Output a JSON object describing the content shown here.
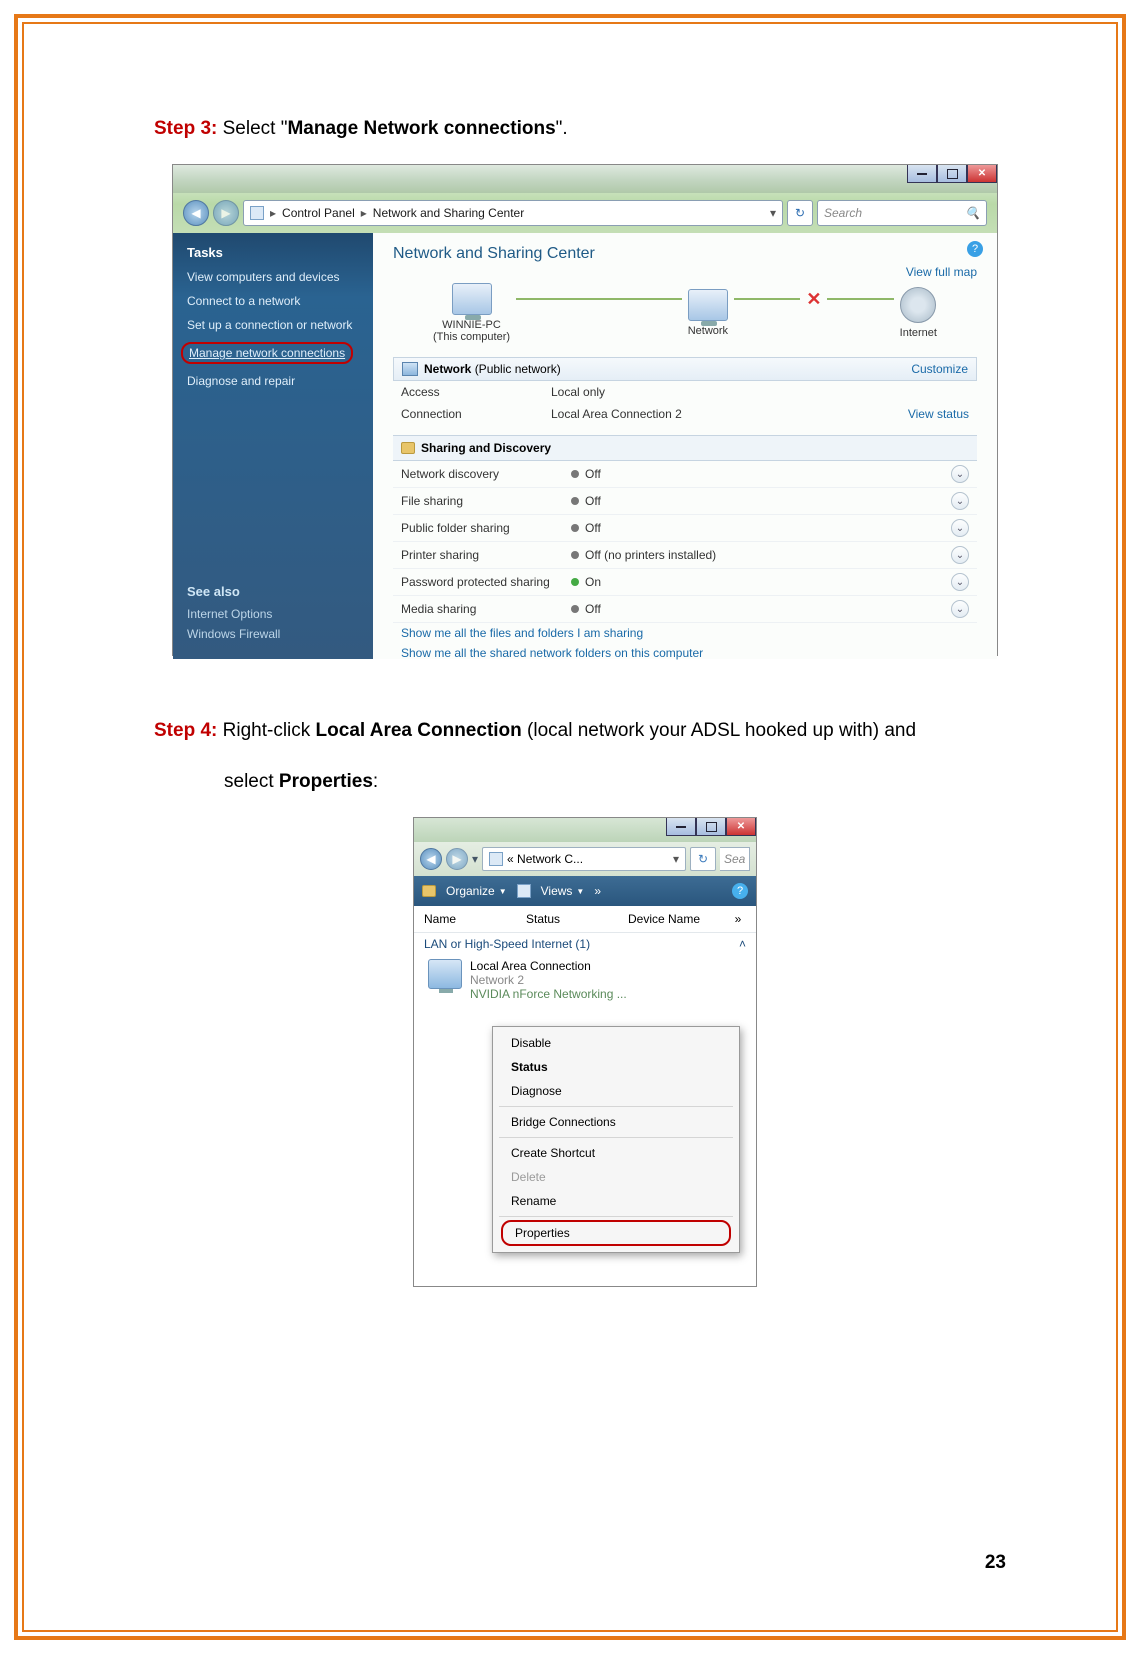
{
  "step3": {
    "label": "Step 3:",
    "before": " Select \"",
    "bold": "Manage Network connections",
    "after": "\"."
  },
  "step4": {
    "label": "Step 4:",
    "before": " Right-click ",
    "bold1": "Local Area Connection",
    "mid": " (local network your ADSL hooked up with) and",
    "line2_before": "select ",
    "bold2": "Properties",
    "line2_after": ":"
  },
  "page_number": "23",
  "shot1": {
    "breadcrumb": {
      "root": "Control Panel",
      "leaf": "Network and Sharing Center"
    },
    "search_placeholder": "Search",
    "sidebar": {
      "tasks_header": "Tasks",
      "tasks": [
        "View computers and devices",
        "Connect to a network",
        "Set up a connection or network",
        "Manage network connections",
        "Diagnose and repair"
      ],
      "seealso_header": "See also",
      "seealso": [
        "Internet Options",
        "Windows Firewall"
      ]
    },
    "main": {
      "title": "Network and Sharing Center",
      "view_full_map": "View full map",
      "nodes": {
        "pc": "WINNIE-PC",
        "pc_sub": "(This computer)",
        "net": "Network",
        "internet": "Internet"
      },
      "network_bar": {
        "name": "Network",
        "type": "(Public network)",
        "customize": "Customize"
      },
      "access": {
        "k": "Access",
        "v": "Local only"
      },
      "connection": {
        "k": "Connection",
        "v": "Local Area Connection 2",
        "r": "View status"
      },
      "sd_header": "Sharing and Discovery",
      "sd_rows": [
        {
          "k": "Network discovery",
          "v": "Off",
          "status": "off"
        },
        {
          "k": "File sharing",
          "v": "Off",
          "status": "off"
        },
        {
          "k": "Public folder sharing",
          "v": "Off",
          "status": "off"
        },
        {
          "k": "Printer sharing",
          "v": "Off (no printers installed)",
          "status": "off"
        },
        {
          "k": "Password protected sharing",
          "v": "On",
          "status": "on"
        },
        {
          "k": "Media sharing",
          "v": "Off",
          "status": "off"
        }
      ],
      "link1": "Show me all the files and folders I am sharing",
      "link2": "Show me all the shared network folders on this computer"
    }
  },
  "shot2": {
    "crumb": "« Network C...",
    "search_placeholder": "Sea",
    "toolbar": {
      "organize": "Organize",
      "views": "Views",
      "more": "»"
    },
    "columns": [
      "Name",
      "Status",
      "Device Name"
    ],
    "more_cols": "»",
    "group": "LAN or High-Speed Internet (1)",
    "connection": {
      "name": "Local Area Connection",
      "net": "Network 2",
      "dev": "NVIDIA nForce Networking ..."
    },
    "menu": [
      {
        "label": "Disable",
        "type": "normal"
      },
      {
        "label": "Status",
        "type": "bold"
      },
      {
        "label": "Diagnose",
        "type": "normal"
      },
      {
        "label": "Bridge Connections",
        "type": "normal",
        "sep_before": true
      },
      {
        "label": "Create Shortcut",
        "type": "normal",
        "sep_before": true
      },
      {
        "label": "Delete",
        "type": "disabled"
      },
      {
        "label": "Rename",
        "type": "normal"
      },
      {
        "label": "Properties",
        "type": "highlighted",
        "sep_before": true
      }
    ]
  }
}
